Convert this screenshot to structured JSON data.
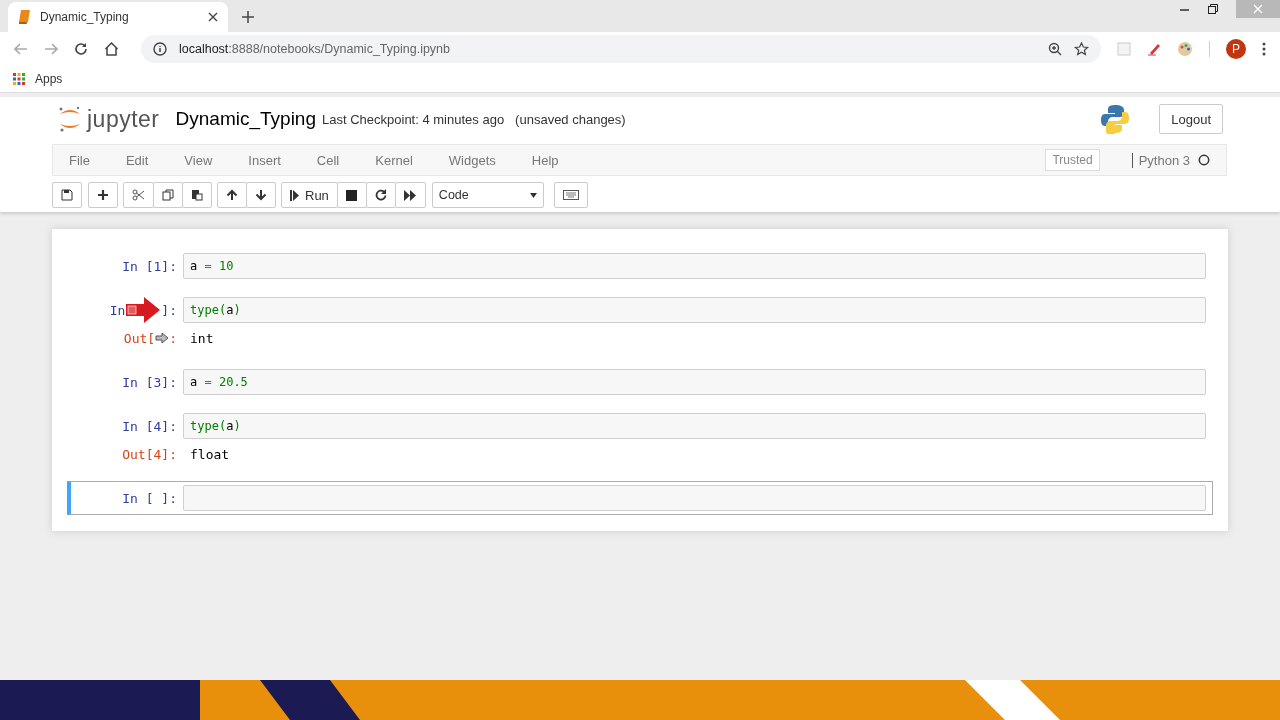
{
  "browser": {
    "tab_title": "Dynamic_Typing",
    "url_host": "localhost",
    "url_rest": ":8888/notebooks/Dynamic_Typing.ipynb",
    "bookmarks": [
      "Apps"
    ],
    "profile_initial": "P"
  },
  "header": {
    "logo_text": "jupyter",
    "notebook_name": "Dynamic_Typing",
    "checkpoint": "Last Checkpoint: 4 minutes ago",
    "unsaved": "(unsaved changes)",
    "logout": "Logout"
  },
  "menu": [
    "File",
    "Edit",
    "View",
    "Insert",
    "Cell",
    "Kernel",
    "Widgets",
    "Help"
  ],
  "trusted": "Trusted",
  "kernel": "Python 3",
  "toolbar": {
    "run": "Run",
    "cell_type": "Code"
  },
  "cells": [
    {
      "prompt": [
        "In [1]:"
      ],
      "code": [
        {
          "kind": "name",
          "text": "a"
        },
        {
          "kind": "op",
          "text": "="
        },
        {
          "kind": "num",
          "text": "10"
        }
      ],
      "selected": false
    },
    {
      "prompt": [
        "In",
        "]:"
      ],
      "code": [
        {
          "kind": "builtin",
          "text": "type"
        },
        {
          "kind": "paren",
          "text": "("
        },
        {
          "kind": "name",
          "text": "a"
        },
        {
          "kind": "paren",
          "text": ")"
        }
      ],
      "out_prompt": [
        "Out[",
        ":"
      ],
      "output": "int",
      "selected": false
    },
    {
      "prompt": [
        "In [3]:"
      ],
      "code": [
        {
          "kind": "name",
          "text": "a"
        },
        {
          "kind": "op",
          "text": "="
        },
        {
          "kind": "num",
          "text": "20.5"
        }
      ],
      "selected": false
    },
    {
      "prompt": [
        "In [4]:"
      ],
      "code": [
        {
          "kind": "builtin",
          "text": "type"
        },
        {
          "kind": "paren",
          "text": "("
        },
        {
          "kind": "name",
          "text": "a"
        },
        {
          "kind": "paren",
          "text": ")"
        }
      ],
      "out_prompt": [
        "Out[4]:"
      ],
      "output": "float",
      "selected": false
    },
    {
      "prompt": [
        "In [ ]:"
      ],
      "selected": true
    }
  ]
}
